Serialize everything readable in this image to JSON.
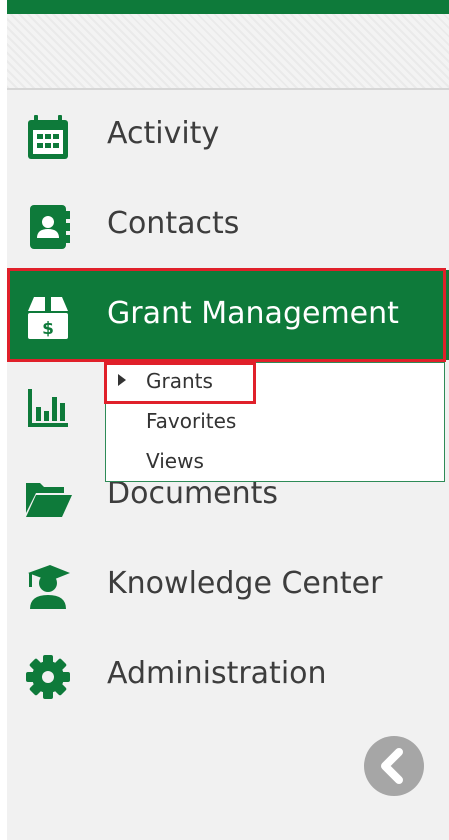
{
  "colors": {
    "brand_green": "#0e7a3a",
    "highlight_red": "#e0202a",
    "sidebar_bg": "#f1f1f1",
    "collapse_gray": "#a6a6a6"
  },
  "nav": {
    "items": [
      {
        "label": "Activity",
        "icon": "calendar-icon"
      },
      {
        "label": "Contacts",
        "icon": "contact-book-icon"
      },
      {
        "label": "Grant Management",
        "icon": "grant-box-dollar-icon",
        "active": true
      },
      {
        "label": "",
        "icon": "bar-chart-icon"
      },
      {
        "label": "Documents",
        "icon": "folder-open-icon"
      },
      {
        "label": "Knowledge Center",
        "icon": "graduate-icon"
      },
      {
        "label": "Administration",
        "icon": "gear-icon"
      }
    ]
  },
  "submenu": {
    "items": [
      "Grants",
      "Favorites",
      "Views"
    ],
    "selected": "Grants"
  },
  "collapse": {
    "icon": "chevron-left-icon"
  }
}
